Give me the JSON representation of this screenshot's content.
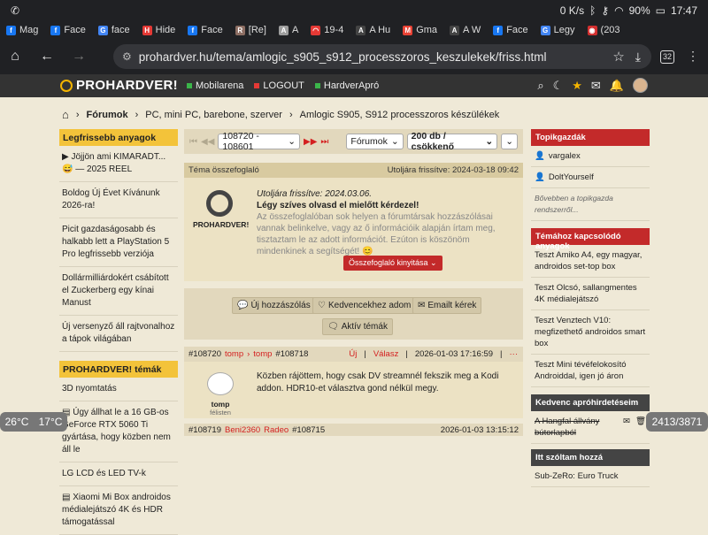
{
  "status_bar": {
    "left": "✆",
    "net": "0 K/s",
    "battery": "90%",
    "time": "17:47"
  },
  "tabs": [
    {
      "label": "Mag",
      "fav": "f",
      "color": "#1877f2"
    },
    {
      "label": "Face",
      "fav": "f",
      "color": "#1877f2"
    },
    {
      "label": "face",
      "fav": "G",
      "color": "#4285f4"
    },
    {
      "label": "Hide",
      "fav": "H",
      "color": "#e53935"
    },
    {
      "label": "Face",
      "fav": "f",
      "color": "#1877f2"
    },
    {
      "label": "[Re]",
      "fav": "R",
      "color": "#8d6e63"
    },
    {
      "label": "A",
      "fav": "A",
      "color": "#9e9e9e"
    },
    {
      "label": "19-4",
      "fav": "◠",
      "color": "#e53935"
    },
    {
      "label": "A Hu",
      "fav": "A",
      "color": "#444"
    },
    {
      "label": "Gma",
      "fav": "M",
      "color": "#ea4335"
    },
    {
      "label": "A W",
      "fav": "A",
      "color": "#444"
    },
    {
      "label": "Face",
      "fav": "f",
      "color": "#1877f2"
    },
    {
      "label": "Legy",
      "fav": "G",
      "color": "#4285f4"
    },
    {
      "label": "(203",
      "fav": "◉",
      "color": "#d32f2f"
    }
  ],
  "url": "prohardver.hu/tema/amlogic_s905_s912_processzoros_keszulekek/friss.html",
  "tab_count": "32",
  "site": {
    "logo": "PROHARDVER!",
    "nav": [
      {
        "label": "Mobilarena",
        "color": "#3bb54a"
      },
      {
        "label": "LOGOUT",
        "color": "#e53935"
      },
      {
        "label": "HardverApró",
        "color": "#3bb54a"
      }
    ]
  },
  "breadcrumb": [
    "Fórumok",
    "PC, mini PC, barebone, szerver",
    "Amlogic S905, S912 processzoros készülékek"
  ],
  "left": {
    "head1": "Legfrissebb anyagok",
    "items1": [
      "▶ Jöjjön ami KIMARADT... 😅 — 2025 REEL",
      "Boldog Új Évet Kívánunk 2026-ra!",
      "Picit gazdaságosabb és halkabb lett a PlayStation 5 Pro legfrissebb verziója",
      "Dollármilliárdokért csábított el Zuckerberg egy kínai Manust",
      "Új versenyző áll rajtvonalhoz a tápok világában"
    ],
    "head2": "PROHARDVER! témák",
    "items2": [
      "3D nyomtatás",
      "▤ Úgy állhat le a 16 GB-os GeForce RTX 5060 Ti gyártása, hogy közben nem áll le",
      "LG LCD és LED TV-k",
      "▤ Xiaomi Mi Box androidos médialejátszó 4K és HDR támogatással"
    ]
  },
  "pager": {
    "range": "108720 - 108601",
    "forum": "Fórumok",
    "per_page": "200 db / csökkenő"
  },
  "summary": {
    "title": "Téma összefoglaló",
    "updated": "Utoljára frissítve: 2024-03-18 09:42",
    "logo": "PROHARDVER!",
    "line1": "Utoljára frissítve: 2024.03.06.",
    "line2": "Légy szíves olvasd el mielőtt kérdezel!",
    "line3": "Az összefoglalóban sok helyen a fórumtársak hozzászólásai vannak belinkelve, vagy az ő információik alapján írtam meg, tisztaztam le az adott információt. Ezúton is köszönöm mindenkinek a segítségét! 😊",
    "expand": "Összefoglaló kinyitása ⌄"
  },
  "actions": {
    "new_post": "Új hozzászólás",
    "favorite": "Kedvencekhez adom",
    "email": "Emailt kérek",
    "active": "Aktív témák"
  },
  "post": {
    "id": "#108720",
    "user": "tomp",
    "arrow": "›",
    "reply_to": "tomp",
    "reply_id": "#108718",
    "new": "Új",
    "reply": "Válasz",
    "date": "2026-01-03 17:16:59",
    "more": "···",
    "author": "tomp",
    "status": "félisten",
    "text": "Közben rájöttem, hogy csak DV streamnél fekszik meg a Kodi addon. HDR10-et választva gond nélkül megy."
  },
  "post2": {
    "id": "#108719",
    "user": "Beni2360",
    "reply_to": "Radeo",
    "reply_id": "#108715",
    "date": "2026-01-03 13:15:12"
  },
  "right": {
    "head1": "Topikgazdák",
    "owners": [
      "vargalex",
      "DoltYourself"
    ],
    "owners_more": "Bővebben a topikgazda rendszerről...",
    "head2": "Témához kapcsolódó anyagok",
    "items": [
      "Teszt Amiko A4, egy magyar, androidos set-top box",
      "Teszt Olcsó, sallangmentes 4K médialejátszó",
      "Teszt Venztech V10: megfizethető androidos smart box",
      "Teszt Mini tévéfelokosító Androiddal, igen jó áron"
    ],
    "head3": "Kedvenc apróhirdetéseim",
    "ad": "A Hangfal állvány bútorlapból",
    "head4": "Itt szóltam hozzá",
    "last": "Sub-ZeRo: Euro Truck"
  },
  "overlays": {
    "temp1": "26°C",
    "temp2": "17°C",
    "count": "2413/3871"
  }
}
